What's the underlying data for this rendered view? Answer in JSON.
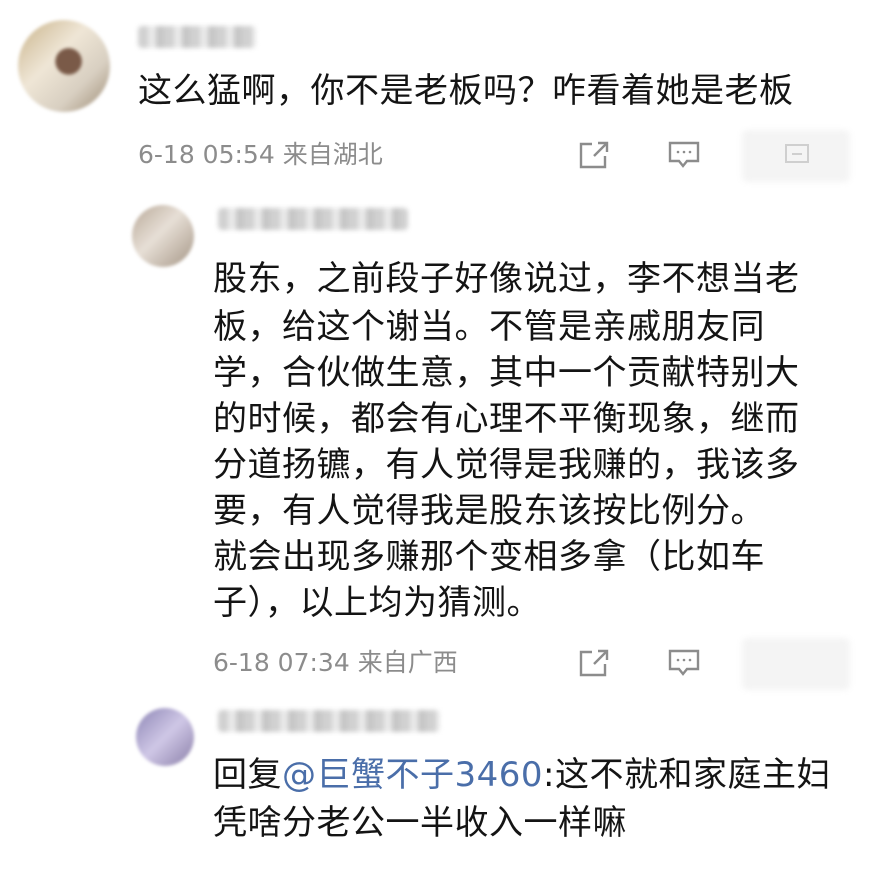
{
  "comment": {
    "text": "这么猛啊，你不是老板吗？咋看着她是老板",
    "date": "6-18 05:54",
    "location": "来自湖北",
    "icons": [
      "share-icon",
      "comment-icon",
      "like-icon"
    ]
  },
  "reply1": {
    "lines": [
      "股东，之前段子好像说过，李不想当老",
      "板，给这个谢当。不管是亲戚朋友同",
      "学，合伙做生意，其中一个贡献特别大",
      "的时候，都会有心理不平衡现象，继而",
      "分道扬镳，有人觉得是我赚的，我该多",
      "要，有人觉得我是股东该按比例分。",
      "就会出现多赚那个变相多拿（比如车",
      "子），以上均为猜测。"
    ],
    "date": "6-18 07:34",
    "location": "来自广西",
    "icons": [
      "share-icon",
      "comment-icon"
    ]
  },
  "reply2": {
    "prefix": "回复",
    "mention": "@巨蟹不子3460",
    "line1_rest": ":这不就和家庭主妇",
    "line2": "凭啥分老公一半收入一样嘛"
  },
  "colors": {
    "text": "#141414",
    "meta": "#8c8c8c",
    "mention": "#4a6ea9",
    "icon": "#8c8c8c"
  }
}
